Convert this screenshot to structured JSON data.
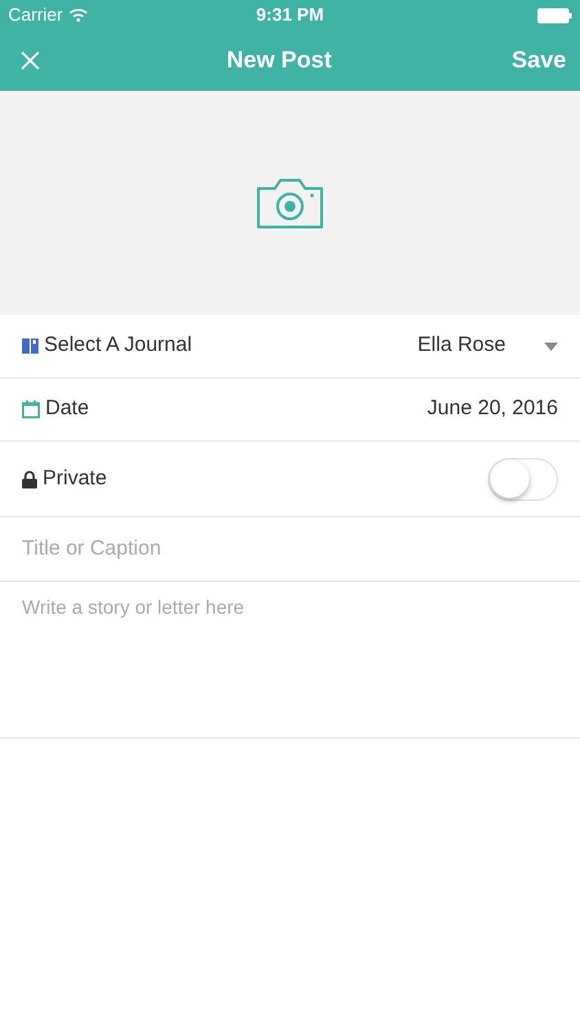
{
  "status_bar": {
    "carrier": "Carrier",
    "time": "9:31 PM"
  },
  "nav": {
    "title": "New Post",
    "action": "Save"
  },
  "photo": {
    "kind": "camera"
  },
  "rows": [
    {
      "kind": "journal",
      "label": "Select A Journal",
      "value": "Ella Rose"
    },
    {
      "kind": "date",
      "label": "Date",
      "value": "June 20, 2016"
    },
    {
      "kind": "private",
      "label": "Private",
      "on": false
    }
  ],
  "title_field": {
    "placeholder": "Title or Caption"
  },
  "story_field": {
    "placeholder": "Write a story or letter here"
  }
}
